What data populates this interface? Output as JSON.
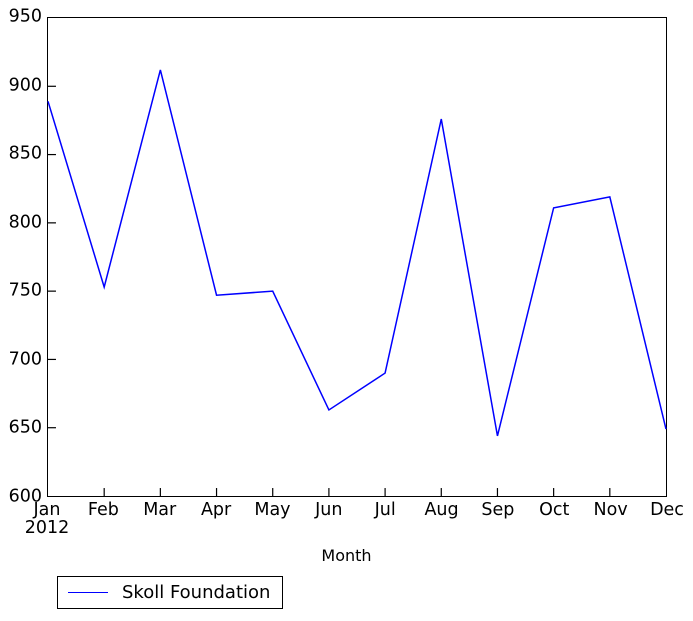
{
  "chart_data": {
    "type": "line",
    "title": "",
    "xlabel": "Month",
    "ylabel": "",
    "categories": [
      "Jan",
      "Feb",
      "Mar",
      "Apr",
      "May",
      "Jun",
      "Jul",
      "Aug",
      "Sep",
      "Oct",
      "Nov",
      "Dec"
    ],
    "x_sub_label": "2012",
    "series": [
      {
        "name": "Skoll Foundation",
        "color": "#0000ff",
        "values": [
          889,
          753,
          912,
          747,
          750,
          663,
          690,
          876,
          644,
          811,
          819,
          649
        ]
      }
    ],
    "ylim": [
      600,
      950
    ],
    "y_ticks": [
      600,
      650,
      700,
      750,
      800,
      850,
      900,
      950
    ],
    "y_tick_labels": [
      "600",
      "650",
      "700",
      "750",
      "800",
      "850",
      "900",
      "950"
    ],
    "xlim": [
      0,
      11
    ],
    "grid": false,
    "legend_position": "below-left",
    "legend_entries": [
      "Skoll Foundation"
    ]
  },
  "axis": {
    "x_title": "Month"
  }
}
